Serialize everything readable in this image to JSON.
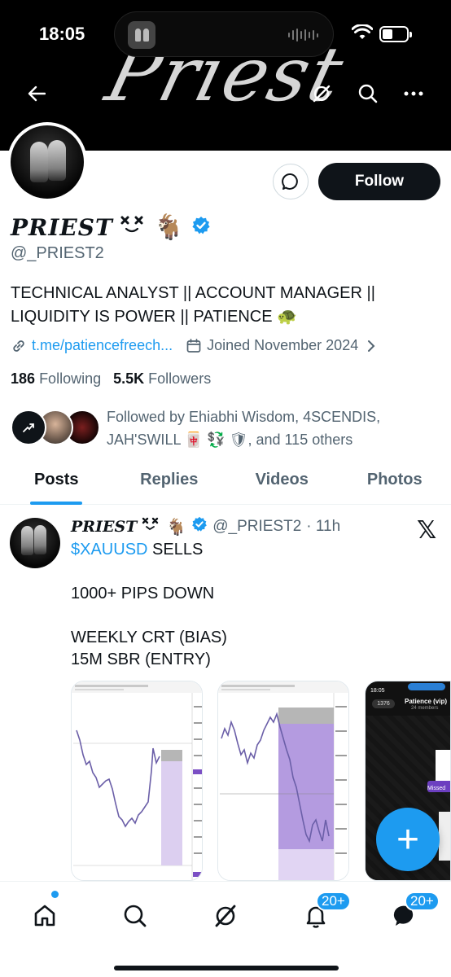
{
  "status_bar": {
    "time": "18:05"
  },
  "banner": {
    "script_text": "Priest"
  },
  "profile": {
    "display_name": "𝑷𝑹𝑰𝑬𝑺𝑻",
    "name_emoji": "🐐",
    "handle": "@_PRIEST2",
    "bio_line1": "TECHNICAL ANALYST || ACCOUNT MANAGER ||",
    "bio_line2": "LIQUIDITY IS POWER || PATIENCE 🐢",
    "link": "t.me/patiencefreech...",
    "joined": "Joined November 2024",
    "following_count": "186",
    "following_label": "Following",
    "followers_count": "5.5K",
    "followers_label": "Followers",
    "followed_by_line1": "Followed by Ehiabhi Wisdom, 4SCENDIS,",
    "followed_by_line2": "JAH'SWILL 🀄 💱 🛡, and 115 others",
    "follow_label": "Follow"
  },
  "tabs": [
    "Posts",
    "Replies",
    "Videos",
    "Photos"
  ],
  "active_tab": "Posts",
  "post": {
    "name": "𝑷𝑹𝑰𝑬𝑺𝑻",
    "handle": "@_PRIEST2",
    "time": "· 11h",
    "tag": "$XAUUSD",
    "line1_rest": " SELLS",
    "line2": "1000+ PIPS DOWN",
    "line3": "WEEKLY CRT (BIAS)",
    "line4": "15M SBR (ENTRY)",
    "media3_title": "Patience (vip)",
    "media3_sub": "24 members",
    "media3_back": "1376",
    "media3_status": "Missed"
  },
  "fab_label": "+",
  "nav": {
    "notifications_badge": "20+",
    "messages_badge": "20+"
  },
  "colors": {
    "accent": "#1d9bf0",
    "text": "#0f1419",
    "muted": "#536471"
  }
}
